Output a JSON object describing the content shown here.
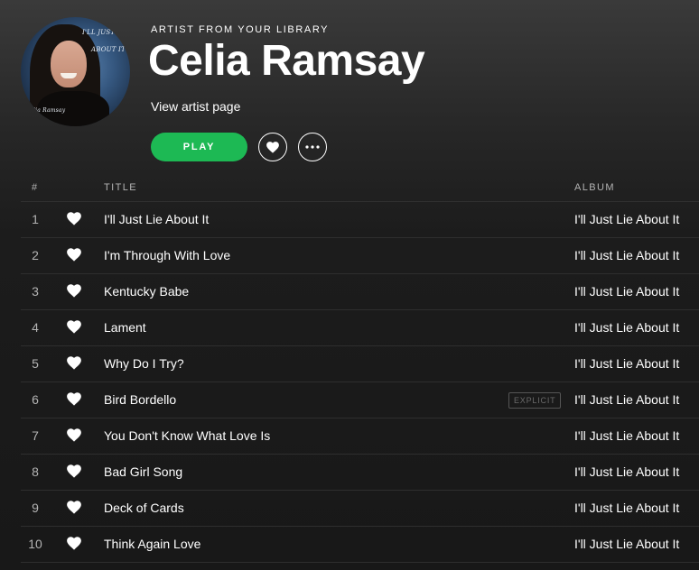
{
  "header": {
    "avatar_text": {
      "line1": "I'LL JUST",
      "line2": "ABOUT IT",
      "line3": "lia Ramsay"
    },
    "eyebrow": "ARTIST FROM YOUR LIBRARY",
    "artist_name": "Celia Ramsay",
    "view_artist_label": "View artist page",
    "play_label": "PLAY",
    "like_icon": "heart-icon",
    "more_icon": "more-horizontal-icon"
  },
  "colors": {
    "accent": "#1db954",
    "background": "#181818",
    "text_primary": "#ffffff",
    "text_secondary": "#b3b3b3"
  },
  "table": {
    "columns": {
      "num": "#",
      "title": "TITLE",
      "album": "ALBUM"
    },
    "explicit_label": "EXPLICIT",
    "rows": [
      {
        "num": "1",
        "title": "I'll Just Lie About It",
        "album": "I'll Just Lie About It",
        "liked": true,
        "explicit": false
      },
      {
        "num": "2",
        "title": "I'm Through With Love",
        "album": "I'll Just Lie About It",
        "liked": true,
        "explicit": false
      },
      {
        "num": "3",
        "title": "Kentucky Babe",
        "album": "I'll Just Lie About It",
        "liked": true,
        "explicit": false
      },
      {
        "num": "4",
        "title": "Lament",
        "album": "I'll Just Lie About It",
        "liked": true,
        "explicit": false
      },
      {
        "num": "5",
        "title": "Why Do I Try?",
        "album": "I'll Just Lie About It",
        "liked": true,
        "explicit": false
      },
      {
        "num": "6",
        "title": "Bird Bordello",
        "album": "I'll Just Lie About It",
        "liked": true,
        "explicit": true
      },
      {
        "num": "7",
        "title": "You Don't Know What Love Is",
        "album": "I'll Just Lie About It",
        "liked": true,
        "explicit": false
      },
      {
        "num": "8",
        "title": "Bad Girl Song",
        "album": "I'll Just Lie About It",
        "liked": true,
        "explicit": false
      },
      {
        "num": "9",
        "title": "Deck of Cards",
        "album": "I'll Just Lie About It",
        "liked": true,
        "explicit": false
      },
      {
        "num": "10",
        "title": "Think Again Love",
        "album": "I'll Just Lie About It",
        "liked": true,
        "explicit": false
      }
    ]
  }
}
